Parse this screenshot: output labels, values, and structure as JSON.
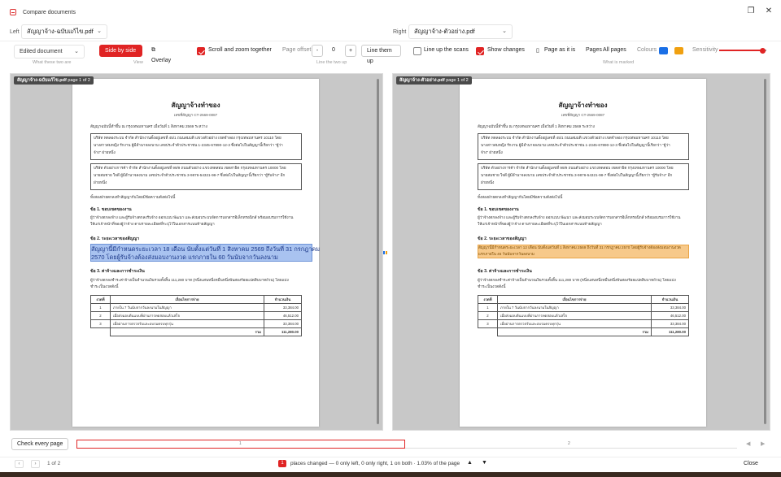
{
  "window": {
    "title": "Compare documents",
    "restore_icon": "restore-icon",
    "close_icon": "close-icon"
  },
  "files": {
    "left_label": "Left",
    "left_file": "สัญญาจ้าง-ฉบับแก้ไข.pdf",
    "right_label": "Right",
    "right_file": "สัญญาจ้าง-ตัวอย่าง.pdf"
  },
  "toolbar": {
    "mode_select": "Edited document",
    "mode_caption": "What these two are",
    "side_by_side": "Side by side",
    "overlay": "Overlay",
    "view_caption": "View",
    "scroll_together": "Scroll and zoom together",
    "page_offset_label": "Page offset",
    "offset_minus": "-",
    "offset_value": "0",
    "offset_plus": "+",
    "line_up_button": "Line them up",
    "line_up_caption": "Line the two up",
    "line_up_scans": "Line up the scans",
    "show_changes": "Show changes",
    "page_as_is": "Page as it is",
    "pages_label": "Pages",
    "pages_value": "All pages",
    "marked_caption": "What is marked",
    "colours_label": "Colours",
    "colour_left": "#1a6fe6",
    "colour_right": "#f0a010",
    "sensitivity_label": "Sensitivity",
    "sensitivity_level": 0.92
  },
  "left_pane": {
    "tag_file": "สัญญาจ้าง-ฉบับแก้ไข.pdf",
    "tag_page": "page 1 of 2",
    "highlight_line1": "สัญญานี้มีกำหนดระยะเวลา 18 เดือน นับตั้งแต่วันที่ 1 สิงหาคม 2569 ถึงวันที่ 31 กรกฎาคม",
    "highlight_line2": "2570 โดยผู้รับจ้างต้องส่งมอบงานงวด แรกภายใน 60 วันนับจากวันลงนาม"
  },
  "right_pane": {
    "tag_file": "สัญญาจ้าง-ตัวอย่าง.pdf",
    "tag_page": "page 1 of 2",
    "highlight_line1": "สัญญานี้มีกำหนดระยะเวลา 12 เดือน นับตั้งแต่วันที่ 1 สิงหาคม 2569 ถึงวันที่ 31 กรกฎาคม 2570 โดยผู้รับจ้างต้องส่งมอบงานงวด",
    "highlight_line2": "แรกภายใน 45 วันนับจากวันลงนาม"
  },
  "doc": {
    "title": "สัญญาจ้างทำของ",
    "contract_no": "เลขที่สัญญา CT-2569-0087",
    "intro": "สัญญาฉบับนี้ทำขึ้น ณ กรุงเทพมหานคร เมื่อวันที่ 1 สิงหาคม 2569 ระหว่าง",
    "party1_l1": "บริษัท ทดลองระบบ จำกัด สำนักงานตั้งอยู่เลขที่ 45/1 ถนนสมมติ แขวงตัวอย่าง เขตจำลอง กรุงเทพมหานคร 10110 โดย",
    "party1_l2": "นางสาวสมหญิง รักงาน ผู้มีอำนาจลงนาม เลขประจำตัวประชาชน 1-2345-67890-12-3 ซึ่งต่อไปในสัญญานี้เรียกว่า \"ผู้ว่า",
    "party1_l3": "จ้าง\" ฝ่ายหนึ่ง",
    "party2_l1": "บริษัท ตัวอย่างการค้า จำกัด สำนักงานตั้งอยู่เลขที่ 99/9 ถนนตัวอย่าง แขวงทดสอบ เขตสาธิต กรุงเทพมหานคร 10000 โดย",
    "party2_l2": "นายสมชาย ใจดี ผู้มีอำนาจลงนาม เลขประจำตัวประชาชน 3-9876-54321-98-7 ซึ่งต่อไปในสัญญานี้เรียกว่า \"ผู้รับจ้าง\" อีก",
    "party2_l3": "ฝ่ายหนึ่ง",
    "agree": "ทั้งสองฝ่ายตกลงทำสัญญากันโดยมีข้อความดังต่อไปนี้",
    "clause1_h": "ข้อ 1. ขอบเขตของงาน",
    "clause1_l1": "ผู้ว่าจ้างตกลงจ้าง และผู้รับจ้างตกลงรับจ้าง ออกแบบ พัฒนา และส่งมอบระบบจัดการเอกสารอิเล็กทรอนิกส์ พร้อมอบรมการใช้งาน",
    "clause1_l2": "ให้แก่เจ้าหน้าที่ของผู้ว่าจ้าง ตามรายละเอียดที่ระบุไว้ในเอกสารแนบท้ายสัญญา",
    "clause2_h": "ข้อ 2. ระยะเวลาของสัญญา",
    "clause3_h": "ข้อ 3. ค่าจ้างและการชำระเงิน",
    "clause3_l1": "ผู้ว่าจ้างตกลงชำระค่าจ้างเป็นจำนวนเงินรวมทั้งสิ้น 111,280 บาท (หนึ่งแสนหนึ่งหมื่นหนึ่งพันสองร้อยแปดสิบบาทถ้วน) โดยแบ่ง",
    "clause3_l2": "ชำระเป็นงวดดังนี้",
    "table": {
      "headers": [
        "งวดที่",
        "เงื่อนไขการจ่าย",
        "จำนวนเงิน"
      ],
      "rows": [
        [
          "1",
          "ภายใน 7 วันนับจากวันลงนามในสัญญา",
          "33,384.00"
        ],
        [
          "2",
          "เมื่อส่งมอบต้นแบบที่ผ่านการทดสอบแล้วเสร็จ",
          "46,512.00"
        ],
        [
          "3",
          "เมื่อผ่านการตรวจรับและอบรมครบทุกรุ่น",
          "33,384.00"
        ]
      ],
      "total_label": "รวม",
      "total_value": "111,280.00"
    }
  },
  "bottom": {
    "check_every_page": "Check every page",
    "strip_page1": "1",
    "strip_page2": "2",
    "prev_icon": "‹",
    "next_icon": "›",
    "page_count": "1 of 2",
    "changes_count": "1",
    "changes_text": "places changed — 0 only left, 0 only right, 1 on both · 1.03% of the page",
    "up_icon": "▲",
    "down_icon": "▼",
    "close": "Close"
  }
}
